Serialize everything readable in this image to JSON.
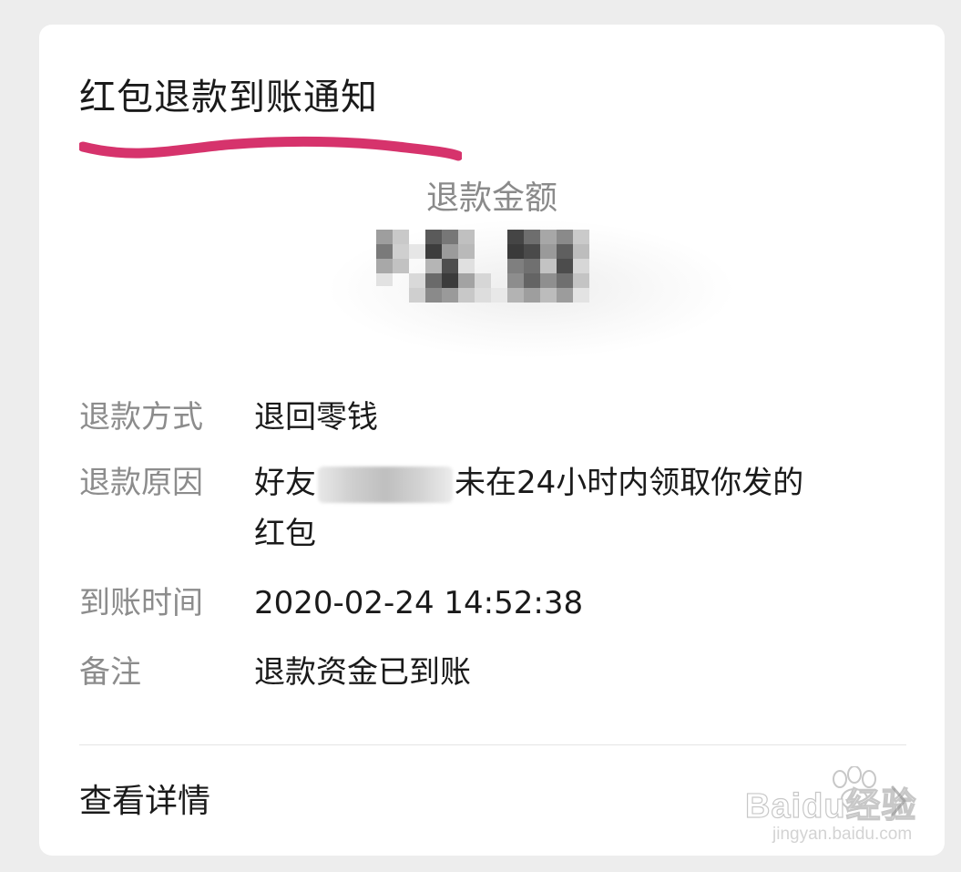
{
  "notification": {
    "title": "红包退款到账通知",
    "amount_label": "退款金额",
    "amount_value": "12.80"
  },
  "rows": [
    {
      "label": "退款方式",
      "value": "退回零钱"
    },
    {
      "label": "退款原因",
      "value_prefix": "好友",
      "value_suffix": "未在24小时内领取你发的",
      "value_line2": "红包"
    },
    {
      "label": "到账时间",
      "value": "2020-02-24 14:52:38"
    },
    {
      "label": "备注",
      "value": "退款资金已到账"
    }
  ],
  "footer": {
    "details_label": "查看详情"
  },
  "watermark": {
    "brand": "Baidu经验",
    "url": "jingyan.baidu.com"
  },
  "colors": {
    "background": "#ededed",
    "card": "#ffffff",
    "highlight_underline": "#d6336c",
    "label_gray": "#8c8c8c",
    "text_dark": "#1a1a1a"
  }
}
